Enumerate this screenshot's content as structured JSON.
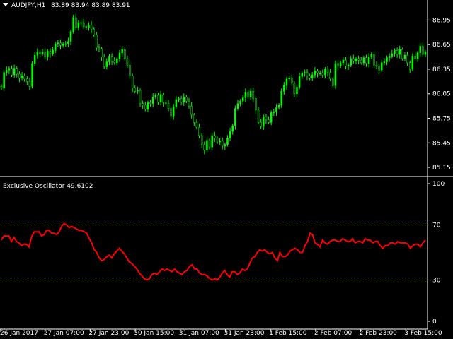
{
  "header": {
    "arrow_icon": "triangle-down-icon",
    "symbol": "AUDJPY,H1",
    "ohlc": "83.89 83.94 83.89 83.91"
  },
  "oscillator": {
    "label": "Exclusive Oscillator 49.6102"
  },
  "colors": {
    "background": "#000000",
    "up_candle": "#00ff00",
    "oscillator": "#ff0000",
    "levels": "#ffff66",
    "separator": "#ffffff"
  },
  "chart_data": [
    {
      "type": "candlestick",
      "ylim": [
        85.09,
        87.04
      ],
      "y_ticks": [
        "86.95",
        "86.65",
        "86.35",
        "86.05",
        "85.75",
        "85.45",
        "85.15"
      ],
      "close": [
        86.12,
        86.31,
        86.34,
        86.36,
        86.28,
        86.36,
        86.29,
        86.24,
        86.27,
        86.23,
        86.2,
        86.14,
        86.42,
        86.52,
        86.56,
        86.54,
        86.56,
        86.5,
        86.57,
        86.54,
        86.58,
        86.66,
        86.67,
        86.64,
        86.66,
        86.66,
        86.69,
        86.81,
        86.98,
        86.86,
        86.92,
        86.92,
        86.87,
        86.86,
        86.89,
        86.84,
        86.77,
        86.61,
        86.6,
        86.5,
        86.38,
        86.44,
        86.51,
        86.45,
        86.43,
        86.48,
        86.55,
        86.59,
        86.48,
        86.4,
        86.27,
        86.12,
        86.08,
        86.09,
        85.93,
        85.91,
        85.86,
        85.94,
        85.93,
        86.01,
        86.03,
        85.95,
        86.04,
        85.94,
        85.93,
        85.87,
        85.78,
        85.89,
        85.98,
        85.99,
        85.95,
        86.01,
        85.96,
        85.9,
        85.79,
        85.7,
        85.64,
        85.54,
        85.43,
        85.36,
        85.48,
        85.4,
        85.54,
        85.51,
        85.46,
        85.47,
        85.41,
        85.43,
        85.51,
        85.59,
        85.66,
        85.87,
        85.93,
        85.96,
        86.0,
        86.07,
        86.01,
        86.08,
        85.99,
        85.85,
        85.7,
        85.65,
        85.77,
        85.73,
        85.7,
        85.82,
        85.83,
        85.88,
        85.91,
        86.08,
        86.15,
        86.23,
        86.24,
        86.18,
        86.05,
        86.13,
        86.26,
        86.3,
        86.31,
        86.27,
        86.24,
        86.28,
        86.33,
        86.3,
        86.3,
        86.28,
        86.35,
        86.31,
        86.23,
        86.15,
        86.42,
        86.39,
        86.43,
        86.46,
        86.39,
        86.4,
        86.48,
        86.45,
        86.48,
        86.46,
        86.43,
        86.49,
        86.42,
        86.5,
        86.53,
        86.4,
        86.39,
        86.34,
        86.43,
        86.44,
        86.49,
        86.51,
        86.54,
        86.58,
        86.53,
        86.59,
        86.48,
        86.52,
        86.43,
        86.35,
        86.51,
        86.48,
        86.55,
        86.63,
        86.53,
        86.56
      ]
    },
    {
      "type": "line",
      "ylim": [
        0,
        100
      ],
      "y_ticks": [
        "100",
        "70",
        "30",
        "0"
      ],
      "levels": [
        70,
        30
      ],
      "x_ticks": [
        "26 Jan 2017",
        "27 Jan 07:00",
        "27 Jan 23:00",
        "30 Jan 15:00",
        "31 Jan 07:00",
        "31 Jan 23:00",
        "1 Feb 15:00",
        "2 Feb 07:00",
        "2 Feb 23:00",
        "3 Feb 15:00"
      ],
      "series": [
        {
          "name": "Exclusive Oscillator",
          "values": [
            59,
            62,
            62,
            62,
            58,
            61,
            58,
            57,
            55,
            56,
            56,
            54,
            61,
            65,
            65,
            65,
            62,
            63,
            66,
            66,
            64,
            64,
            63,
            65,
            69,
            71,
            70,
            68,
            69,
            68,
            67,
            66,
            66,
            65,
            64,
            60,
            57,
            52,
            50,
            46,
            44,
            45,
            47,
            48,
            46,
            49,
            51,
            53,
            51,
            49,
            46,
            43,
            42,
            40,
            38,
            35,
            33,
            31,
            30,
            31,
            34,
            35,
            34,
            36,
            38,
            37,
            38,
            37,
            36,
            38,
            36,
            35,
            34,
            36,
            37,
            40,
            41,
            38,
            38,
            35,
            34,
            34,
            33,
            31,
            30,
            31,
            30,
            32,
            35,
            37,
            34,
            32,
            36,
            36,
            34,
            35,
            38,
            37,
            38,
            42,
            46,
            47,
            50,
            52,
            51,
            52,
            50,
            49,
            50,
            46,
            44,
            50,
            47,
            47,
            48,
            51,
            52,
            53,
            52,
            50,
            50,
            55,
            58,
            64,
            63,
            57,
            56,
            54,
            59,
            57,
            56,
            58,
            59,
            59,
            58,
            58,
            60,
            59,
            58,
            58,
            60,
            57,
            58,
            58,
            57,
            60,
            59,
            59,
            57,
            58,
            58,
            55,
            53,
            55,
            55,
            57,
            57,
            56,
            58,
            57,
            57,
            57,
            56,
            53,
            55,
            56,
            56,
            54,
            57,
            59
          ]
        }
      ]
    }
  ]
}
